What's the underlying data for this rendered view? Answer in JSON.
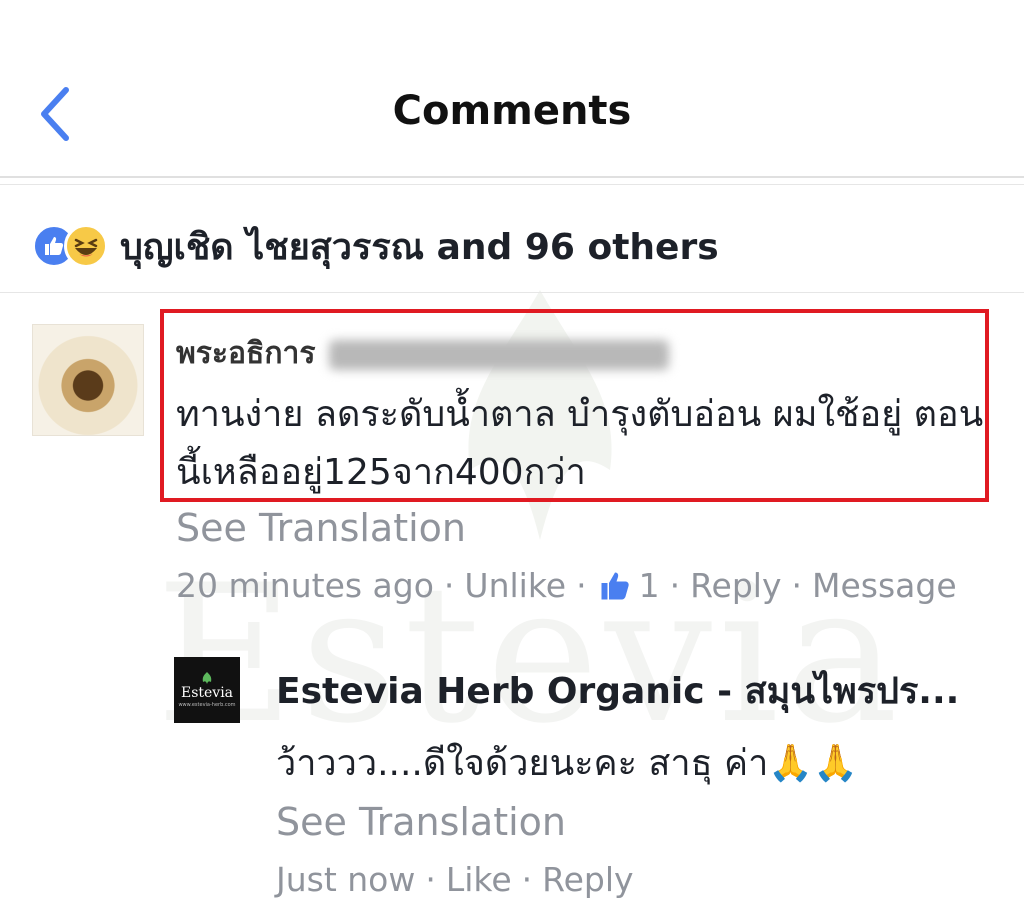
{
  "header": {
    "title": "Comments",
    "back_icon": "chevron-left-icon",
    "accent_color": "#4a7ff0"
  },
  "reactions": {
    "icons": [
      "like-icon",
      "haha-icon"
    ],
    "text": "บุญเชิด ไชยสุวรรณ and 96 others"
  },
  "comment": {
    "author_visible": "พระอธิการ",
    "text": "ทานง่าย  ลดระดับน้ำตาล บำรุงตับอ่อน  ผมใช้อยู่ ตอนนี้เหลืออยู่125จาก400กว่า",
    "see_translation": "See Translation",
    "time": "20 minutes ago",
    "sep": "·",
    "unlike": "Unlike",
    "like_count": "1",
    "reply": "Reply",
    "message": "Message",
    "highlight_color": "#e01a22"
  },
  "reply": {
    "avatar_brand": "Estevia",
    "avatar_url": "www.estevia-herb.com",
    "author": "Estevia Herb Organic - สมุนไพรปร...",
    "text": "ว้าววว....ดีใจด้วยนะคะ สาธุ ค่า🙏🙏",
    "see_translation": "See Translation",
    "time": "Just now",
    "sep": "·",
    "like": "Like",
    "reply_label": "Reply"
  },
  "watermark": "Estevia"
}
